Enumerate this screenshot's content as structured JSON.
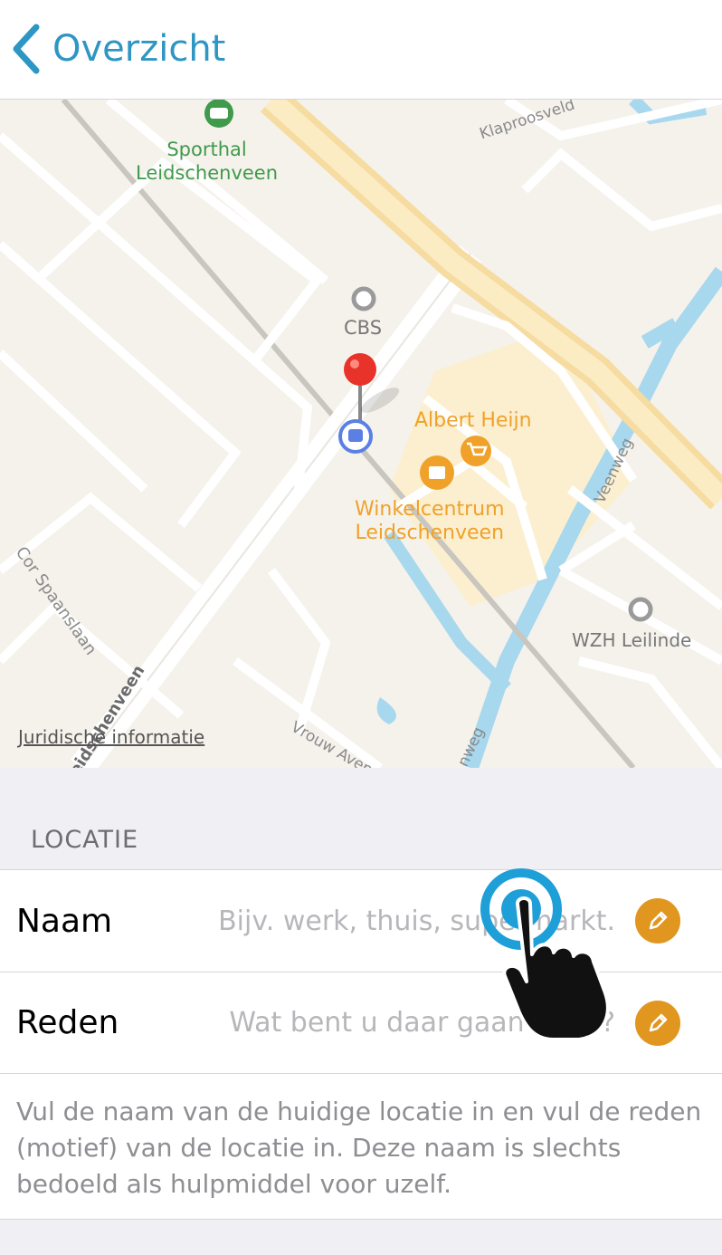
{
  "nav": {
    "back_label": "Overzicht"
  },
  "map": {
    "poi": {
      "sporthal": "Sporthal\nLeidschenveen",
      "cbs": "CBS",
      "albert_heijn": "Albert Heijn",
      "winkelcentrum": "Winkelcentrum\nLeidschenveen",
      "wzh": "WZH Leilinde"
    },
    "streets": {
      "klaproos": "Klaproosveld",
      "cor_spaanslaan": "Cor Spaanslaan",
      "veenweg": "Veenweg",
      "leidschenveen": "Leidschenveen",
      "vrouw_aven": "Vrouw Aven",
      "nweg": "nweg"
    },
    "legal_link": "Juridische informatie"
  },
  "section": {
    "header": "LOCATIE"
  },
  "fields": [
    {
      "label": "Naam",
      "placeholder": "Bijv. werk, thuis, supermarkt.",
      "value": ""
    },
    {
      "label": "Reden",
      "placeholder": "Wat bent u daar gaan doen?",
      "value": ""
    }
  ],
  "footer": {
    "text": "Vul de naam van de huidige locatie in en vul de reden (motief) van de locatie in. Deze naam is slechts bedoeld als hulpmiddel voor uzelf."
  },
  "colors": {
    "accent": "#2e96c4",
    "edit": "#e0961f",
    "poi_orange": "#f0a12a",
    "poi_green": "#3f9a4b",
    "pin_red": "#e8332a",
    "water": "#a8d8ee"
  }
}
